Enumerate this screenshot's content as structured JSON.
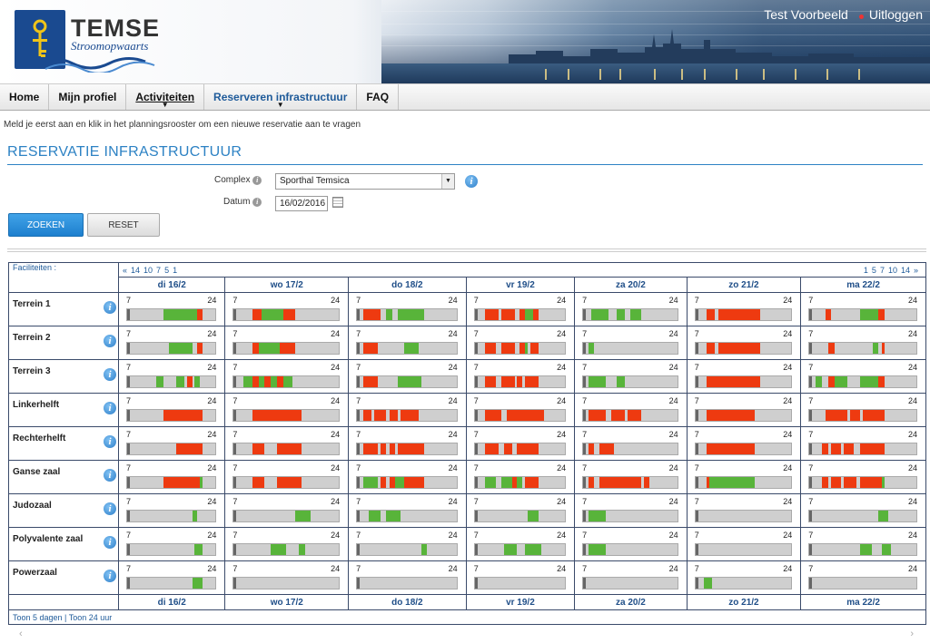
{
  "header": {
    "user": "Test Voorbeeld",
    "logout": "Uitloggen",
    "logo_word": "TEMSE",
    "logo_sub": "Stroomopwaarts"
  },
  "nav": [
    {
      "label": "Home"
    },
    {
      "label": "Mijn profiel"
    },
    {
      "label": "Activiteiten"
    },
    {
      "label": "Reserveren infrastructuur"
    },
    {
      "label": "FAQ"
    }
  ],
  "notice": "Meld je eerst aan en klik in het planningsrooster om een nieuwe reservatie aan te vragen",
  "title": "RESERVATIE INFRASTRUCTUUR",
  "form": {
    "complex_label": "Complex",
    "complex_value": "Sporthal Temsica",
    "datum_label": "Datum",
    "datum_value": "16/02/2016"
  },
  "buttons": {
    "search": "ZOEKEN",
    "reset": "RESET"
  },
  "grid": {
    "fac_header": "Faciliteiten :",
    "pag_prev": [
      "«",
      "14",
      "10",
      "7",
      "5",
      "1"
    ],
    "pag_next": [
      "1",
      "5",
      "7",
      "10",
      "14",
      "»"
    ],
    "days": [
      "di 16/2",
      "wo 17/2",
      "do 18/2",
      "vr 19/2",
      "za 20/2",
      "zo 21/2",
      "ma 22/2"
    ],
    "hour_start": "7",
    "hour_end": "24",
    "footer": "Toon 5 dagen | Toon 24 uur"
  },
  "facilities": [
    {
      "name": "Terrein 1",
      "days": [
        [
          [
            "g",
            14,
            20.5
          ],
          [
            "r",
            20.5,
            21.5
          ]
        ],
        [
          [
            "r",
            10,
            11.5
          ],
          [
            "g",
            11.5,
            15
          ],
          [
            "r",
            15,
            17
          ]
        ],
        [
          [
            "r",
            8,
            11
          ],
          [
            "g",
            12,
            13
          ],
          [
            "g",
            14,
            18.5
          ]
        ],
        [
          [
            "r",
            9,
            11.5
          ],
          [
            "r",
            12,
            14.5
          ],
          [
            "r",
            15.5,
            16.5
          ],
          [
            "g",
            16.5,
            18
          ],
          [
            "r",
            18,
            19
          ]
        ],
        [
          [
            "g",
            8.5,
            11.5
          ],
          [
            "g",
            13,
            14.5
          ],
          [
            "g",
            15.5,
            17.5
          ]
        ],
        [
          [
            "r",
            9,
            10.5
          ],
          [
            "r",
            11,
            18.5
          ]
        ],
        [
          [
            "r",
            9.5,
            10.5
          ],
          [
            "g",
            15,
            18
          ],
          [
            "r",
            18,
            19
          ]
        ]
      ]
    },
    {
      "name": "Terrein 2",
      "days": [
        [
          [
            "g",
            15,
            19.5
          ],
          [
            "r",
            20.5,
            21.5
          ]
        ],
        [
          [
            "r",
            10,
            11
          ],
          [
            "g",
            11,
            14.5
          ],
          [
            "r",
            14.5,
            17
          ]
        ],
        [
          [
            "r",
            8,
            10.5
          ],
          [
            "g",
            15,
            17.5
          ]
        ],
        [
          [
            "r",
            9,
            11
          ],
          [
            "r",
            12,
            14.5
          ],
          [
            "r",
            15.5,
            16.5
          ],
          [
            "g",
            16.5,
            17
          ],
          [
            "r",
            17.5,
            19
          ]
        ],
        [
          [
            "g",
            8,
            9
          ]
        ],
        [
          [
            "r",
            9,
            10.5
          ],
          [
            "r",
            11,
            18.5
          ]
        ],
        [
          [
            "r",
            10,
            11
          ],
          [
            "g",
            17,
            18
          ],
          [
            "r",
            18.5,
            19
          ]
        ]
      ]
    },
    {
      "name": "Terrein 3",
      "days": [
        [
          [
            "g",
            12.5,
            14
          ],
          [
            "g",
            16.5,
            18
          ],
          [
            "r",
            18.5,
            19.5
          ],
          [
            "g",
            20,
            21
          ]
        ],
        [
          [
            "g",
            8.5,
            10
          ],
          [
            "r",
            10,
            11
          ],
          [
            "g",
            11,
            12
          ],
          [
            "r",
            12,
            13
          ],
          [
            "g",
            13,
            14
          ],
          [
            "r",
            14,
            15
          ],
          [
            "g",
            15,
            16.5
          ]
        ],
        [
          [
            "r",
            8,
            10.5
          ],
          [
            "g",
            14,
            18
          ]
        ],
        [
          [
            "r",
            9,
            11
          ],
          [
            "r",
            12,
            14.5
          ],
          [
            "r",
            15,
            16
          ],
          [
            "r",
            16.5,
            18
          ],
          [
            "r",
            18,
            19
          ]
        ],
        [
          [
            "g",
            8,
            11
          ],
          [
            "g",
            13,
            14.5
          ]
        ],
        [
          [
            "r",
            9,
            10.5
          ],
          [
            "r",
            10.5,
            18.5
          ]
        ],
        [
          [
            "g",
            8,
            9
          ],
          [
            "r",
            10,
            11
          ],
          [
            "g",
            11,
            13
          ],
          [
            "g",
            15,
            18
          ],
          [
            "r",
            18,
            19
          ]
        ]
      ]
    },
    {
      "name": "Linkerhelft",
      "days": [
        [
          [
            "r",
            14,
            21.5
          ]
        ],
        [
          [
            "r",
            10,
            18
          ]
        ],
        [
          [
            "r",
            8,
            9.5
          ],
          [
            "r",
            10,
            12
          ],
          [
            "r",
            12.5,
            14
          ],
          [
            "r",
            14.5,
            17.5
          ]
        ],
        [
          [
            "r",
            9,
            12
          ],
          [
            "r",
            13,
            20
          ]
        ],
        [
          [
            "r",
            8,
            11
          ],
          [
            "r",
            12,
            14.5
          ],
          [
            "r",
            15,
            17.5
          ]
        ],
        [
          [
            "r",
            9,
            17.5
          ]
        ],
        [
          [
            "r",
            9.5,
            13
          ],
          [
            "r",
            13.5,
            15
          ],
          [
            "r",
            15.5,
            19
          ]
        ]
      ]
    },
    {
      "name": "Rechterhelft",
      "days": [
        [
          [
            "r",
            16.5,
            21.5
          ]
        ],
        [
          [
            "r",
            10,
            12
          ],
          [
            "r",
            14,
            18
          ]
        ],
        [
          [
            "r",
            8,
            10.5
          ],
          [
            "r",
            11,
            12
          ],
          [
            "r",
            12.5,
            13.5
          ],
          [
            "r",
            14,
            18.5
          ]
        ],
        [
          [
            "r",
            9,
            11.5
          ],
          [
            "r",
            12.5,
            14
          ],
          [
            "r",
            15,
            19
          ]
        ],
        [
          [
            "r",
            8,
            9
          ],
          [
            "r",
            10,
            12.5
          ]
        ],
        [
          [
            "r",
            9,
            17.5
          ]
        ],
        [
          [
            "r",
            9,
            10
          ],
          [
            "r",
            10.5,
            12
          ],
          [
            "r",
            12.5,
            14
          ],
          [
            "r",
            15,
            19
          ]
        ]
      ]
    },
    {
      "name": "Ganse zaal",
      "days": [
        [
          [
            "r",
            14,
            21
          ],
          [
            "g",
            21,
            21.5
          ]
        ],
        [
          [
            "r",
            10,
            12
          ],
          [
            "r",
            14,
            18
          ]
        ],
        [
          [
            "g",
            8,
            10.5
          ],
          [
            "r",
            11,
            12
          ],
          [
            "r",
            12.5,
            13.5
          ],
          [
            "g",
            13.5,
            15
          ],
          [
            "r",
            15,
            18.5
          ]
        ],
        [
          [
            "g",
            9,
            11
          ],
          [
            "g",
            12,
            14
          ],
          [
            "r",
            14,
            15
          ],
          [
            "g",
            15,
            16
          ],
          [
            "r",
            16.5,
            19
          ]
        ],
        [
          [
            "r",
            8,
            9
          ],
          [
            "r",
            10,
            17.5
          ],
          [
            "r",
            18,
            19
          ]
        ],
        [
          [
            "r",
            9,
            9.5
          ],
          [
            "g",
            9.5,
            17.5
          ]
        ],
        [
          [
            "r",
            9,
            10
          ],
          [
            "r",
            10.5,
            12
          ],
          [
            "r",
            12.5,
            14.5
          ],
          [
            "r",
            15,
            18.5
          ],
          [
            "g",
            18.5,
            19
          ]
        ]
      ]
    },
    {
      "name": "Judozaal",
      "days": [
        [
          [
            "g",
            19.5,
            20.5
          ]
        ],
        [
          [
            "g",
            17,
            19.5
          ]
        ],
        [
          [
            "g",
            9,
            11
          ],
          [
            "g",
            12,
            14.5
          ]
        ],
        [
          [
            "g",
            17,
            19
          ]
        ],
        [
          [
            "g",
            8,
            9
          ],
          [
            "g",
            9,
            11
          ]
        ],
        [],
        [
          [
            "g",
            18,
            19.5
          ]
        ]
      ]
    },
    {
      "name": "Polyvalente zaal",
      "days": [
        [
          [
            "g",
            20,
            21.5
          ]
        ],
        [
          [
            "g",
            13,
            15.5
          ],
          [
            "g",
            17.5,
            18.5
          ]
        ],
        [
          [
            "g",
            18,
            19
          ]
        ],
        [
          [
            "g",
            12.5,
            15
          ],
          [
            "g",
            16.5,
            19.5
          ]
        ],
        [
          [
            "g",
            8,
            11
          ]
        ],
        [],
        [
          [
            "g",
            15,
            17
          ],
          [
            "g",
            18.5,
            20
          ]
        ]
      ]
    },
    {
      "name": "Powerzaal",
      "days": [
        [
          [
            "g",
            19.5,
            21.5
          ]
        ],
        [],
        [],
        [],
        [],
        [
          [
            "g",
            8.5,
            10
          ]
        ],
        []
      ]
    }
  ]
}
